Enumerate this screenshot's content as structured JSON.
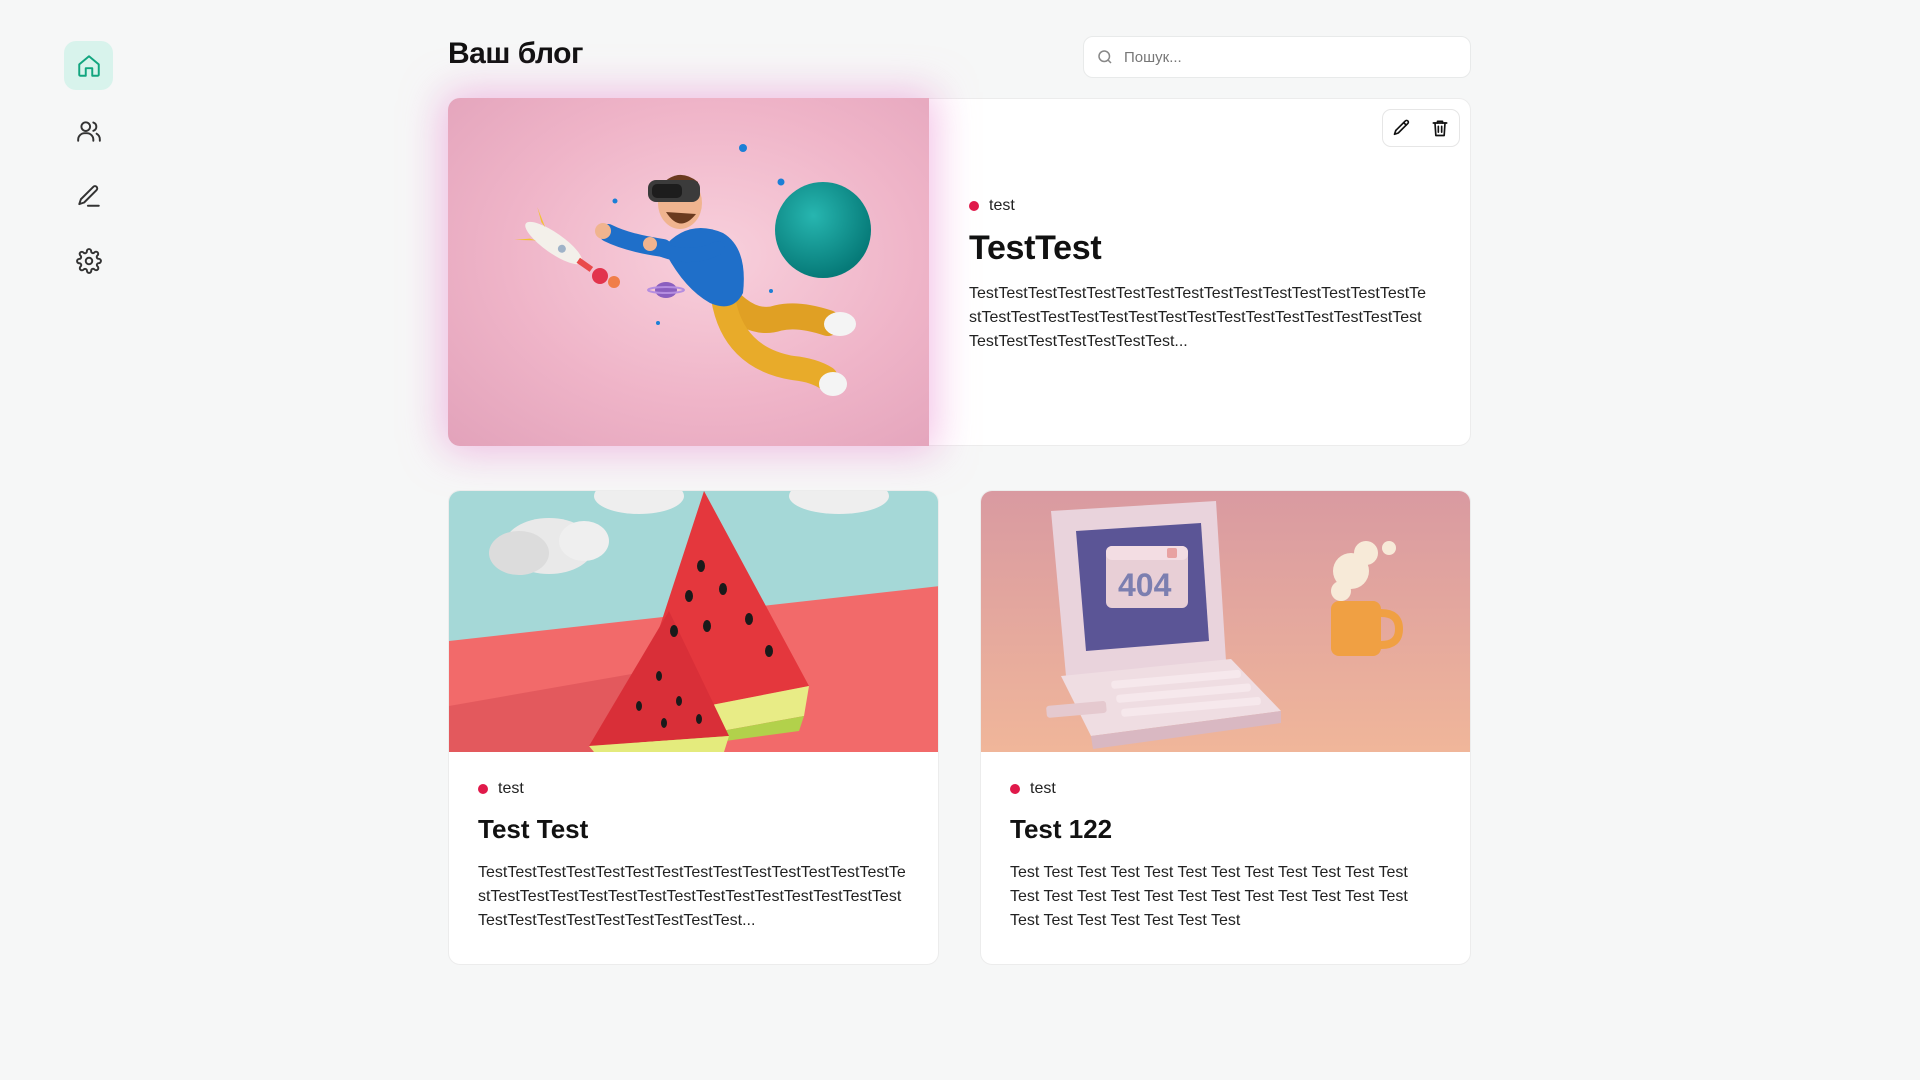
{
  "nav": {
    "items": [
      {
        "name": "home",
        "icon": "home-icon",
        "active": true
      },
      {
        "name": "users",
        "icon": "users-icon",
        "active": false
      },
      {
        "name": "write",
        "icon": "pen-icon",
        "active": false
      },
      {
        "name": "settings",
        "icon": "gear-icon",
        "active": false
      }
    ]
  },
  "header": {
    "title": "Ваш блог",
    "search_placeholder": "Пошук..."
  },
  "featured": {
    "tag": "test",
    "title": "TestTest",
    "excerpt": "TestTestTestTestTestTestTestTestTestTestTestTestTestTestTestTestTestTestTestTestTestTestTestTestTestTestTestTestTestTestTestTestTestTestTestTestTestTest...",
    "tools": [
      "pencil-icon",
      "trash-icon"
    ]
  },
  "posts": [
    {
      "tag": "test",
      "title": "Test Test",
      "excerpt": "TestTestTestTestTestTestTestTestTestTestTestTestTestTestTestTestTestTestTestTestTestTestTestTestTestTestTestTestTestTestTestTestTestTestTestTestTestTest..."
    },
    {
      "tag": "test",
      "title": "Test 122",
      "image_text": "404",
      "excerpt": "Test Test Test Test Test Test Test Test Test Test Test Test Test Test Test Test Test Test Test Test Test Test Test Test Test Test Test Test Test Test Test"
    }
  ],
  "colors": {
    "accent": "#12a57f",
    "accent_bg": "#d8f3ec",
    "tag_dot": "#e0194a",
    "background": "#f6f7f7"
  }
}
